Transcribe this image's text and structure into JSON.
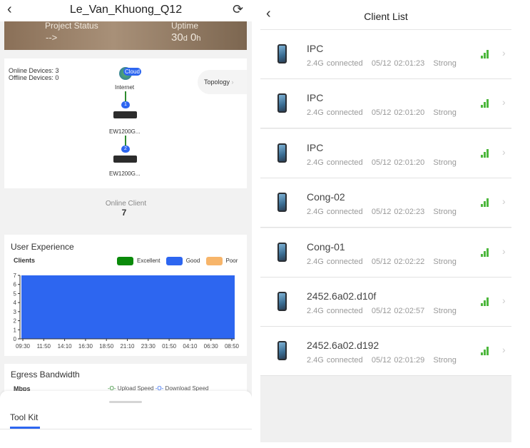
{
  "left": {
    "title": "Le_Van_Khuong_Q12",
    "banner": {
      "status_label": "Project Status",
      "status_value": "-->",
      "uptime_label": "Uptime",
      "uptime_days": "30",
      "uptime_d": "d",
      "uptime_hours": "0",
      "uptime_h": "h"
    },
    "topology": {
      "online": "Online Devices: 3",
      "offline": "Offline Devices: 0",
      "cloud": "Cloud",
      "internet": "Internet",
      "button": "Topology",
      "devices": [
        {
          "badge": "1",
          "name": "EW1200G..."
        },
        {
          "badge": "2",
          "name": "EW1200G..."
        }
      ]
    },
    "online_client": {
      "label": "Online Client",
      "value": "7"
    },
    "user_experience": {
      "title": "User Experience"
    },
    "egress": {
      "title": "Egress Bandwidth",
      "unit": "Mbps",
      "upload": "Upload Speed",
      "download": "Download Speed"
    },
    "toolkit": {
      "tab": "Tool Kit"
    }
  },
  "chart_data": {
    "type": "area",
    "ylabel": "Clients",
    "ylim": [
      0,
      7
    ],
    "yticks": [
      "0",
      "1",
      "2",
      "3",
      "4",
      "5",
      "6",
      "7"
    ],
    "categories": [
      "09:30",
      "11:50",
      "14:10",
      "16:30",
      "18:50",
      "21:10",
      "23:30",
      "01:50",
      "04:10",
      "06:30",
      "08:50"
    ],
    "series": [
      {
        "name": "Excellent",
        "color": "#0a8a0a",
        "values": [
          0,
          0,
          0,
          0,
          0,
          0,
          0,
          0,
          0,
          0,
          0
        ]
      },
      {
        "name": "Good",
        "color": "#2d66f0",
        "values": [
          7,
          7,
          7,
          7,
          7,
          7,
          7,
          7,
          7,
          7,
          7
        ]
      },
      {
        "name": "Poor",
        "color": "#f7b56a",
        "values": [
          0,
          0,
          0,
          0,
          0,
          0,
          0,
          0,
          0,
          0,
          0
        ]
      }
    ]
  },
  "right": {
    "title": "Client List",
    "clients": [
      {
        "name": "IPC",
        "band": "2.4G connected",
        "time": "05/12 02:01:23",
        "signal": "Strong"
      },
      {
        "name": "IPC",
        "band": "2.4G connected",
        "time": "05/12 02:01:20",
        "signal": "Strong"
      },
      {
        "name": "IPC",
        "band": "2.4G connected",
        "time": "05/12 02:01:20",
        "signal": "Strong"
      },
      {
        "name": "Cong-02",
        "band": "2.4G connected",
        "time": "05/12 02:02:23",
        "signal": "Strong"
      },
      {
        "name": "Cong-01",
        "band": "2.4G connected",
        "time": "05/12 02:02:22",
        "signal": "Strong"
      },
      {
        "name": "2452.6a02.d10f",
        "band": "2.4G connected",
        "time": "05/12 02:02:57",
        "signal": "Strong"
      },
      {
        "name": "2452.6a02.d192",
        "band": "2.4G connected",
        "time": "05/12 02:01:29",
        "signal": "Strong"
      }
    ]
  }
}
